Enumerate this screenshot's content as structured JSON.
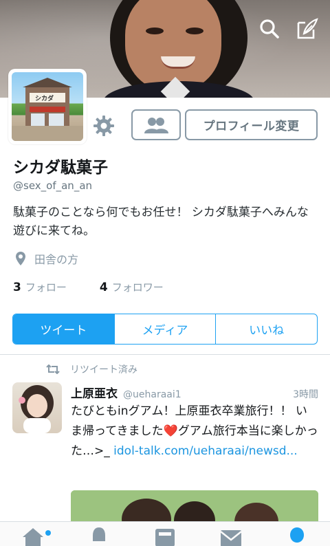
{
  "banner": {
    "search_icon": "search-icon",
    "compose_icon": "compose-tweet-icon"
  },
  "profile": {
    "display_name": "シカダ駄菓子",
    "handle": "@sex_of_an_an",
    "bio": "駄菓子のことなら何でもお任せ！ シカダ駄菓子へみんな遊びに来てね。",
    "location": "田舎の方",
    "avatar_sign": "シカダ",
    "following_count": "3",
    "following_label": "フォロー",
    "followers_count": "4",
    "followers_label": "フォロワー"
  },
  "actions": {
    "edit_profile_label": "プロフィール変更",
    "settings_icon": "gear-icon",
    "follow_icon": "people-icon"
  },
  "tabs": [
    {
      "label": "ツイート",
      "active": true
    },
    {
      "label": "メディア",
      "active": false
    },
    {
      "label": "いいね",
      "active": false
    }
  ],
  "tweet": {
    "retweet_label": "リツイート済み",
    "author_name": "上原亜衣",
    "author_handle": "@ueharaai1",
    "time": "3時間",
    "text_part1": "たびともinグアム！上原亜衣卒業旅行！！ いま帰ってきました",
    "emoji": "❤️",
    "text_part2": "グアム旅行本当に楽しかった…>_ ",
    "link": "idol-talk.com/ueharaai/newsd..."
  },
  "colors": {
    "accent": "#1da1f2",
    "muted": "#8899a6",
    "text": "#14171a",
    "heart": "#e0245e"
  },
  "bottom_nav": {
    "items": [
      "home-icon",
      "notifications-icon",
      "moments-icon",
      "messages-icon",
      "profile-icon"
    ],
    "active": "profile-icon"
  }
}
